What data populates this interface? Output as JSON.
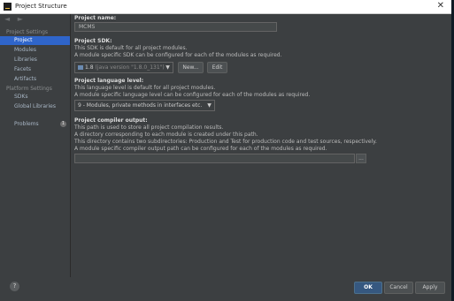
{
  "window": {
    "title": "Project Structure",
    "close_glyph": "✕"
  },
  "sidebar": {
    "nav_arrows": "◄ ►",
    "project_settings_header": "Project Settings",
    "project_settings_items": [
      {
        "label": "Project",
        "selected": true
      },
      {
        "label": "Modules"
      },
      {
        "label": "Libraries"
      },
      {
        "label": "Facets"
      },
      {
        "label": "Artifacts"
      }
    ],
    "platform_settings_header": "Platform Settings",
    "platform_settings_items": [
      {
        "label": "SDKs"
      },
      {
        "label": "Global Libraries"
      }
    ],
    "problems_label": "Problems",
    "problems_count": "1"
  },
  "content": {
    "project_name_label": "Project name:",
    "project_name_value": "MCMS",
    "sdk_label": "Project SDK:",
    "sdk_desc1": "This SDK is default for all project modules.",
    "sdk_desc2": "A module specific SDK can be configured for each of the modules as required.",
    "sdk_value": "1.8",
    "sdk_value_detail": "(java version \"1.8.0_131\")",
    "new_button": "New...",
    "edit_button": "Edit",
    "lang_label": "Project language level:",
    "lang_desc1": "This language level is default for all project modules.",
    "lang_desc2": "A module specific language level can be configured for each of the modules as required.",
    "lang_value": "9 - Modules, private methods in interfaces etc.",
    "output_label": "Project compiler output:",
    "output_desc1": "This path is used to store all project compilation results.",
    "output_desc2": "A directory corresponding to each module is created under this path.",
    "output_desc3": "This directory contains two subdirectories: Production and Test for production code and test sources, respectively.",
    "output_desc4": "A module specific compiler output path can be configured for each of the modules as required.",
    "output_value": "",
    "browse_button": "..."
  },
  "footer": {
    "help_glyph": "?",
    "ok_button": "OK",
    "cancel_button": "Cancel",
    "apply_button": "Apply"
  },
  "colors": {
    "background": "#3c3f41",
    "selection": "#2f65ca",
    "ok_button": "#365880"
  },
  "icons": [
    "app-icon",
    "close-icon",
    "back-arrow-icon",
    "forward-arrow-icon",
    "problems-badge",
    "sdk-folder-icon",
    "chevron-down-icon",
    "help-icon"
  ]
}
